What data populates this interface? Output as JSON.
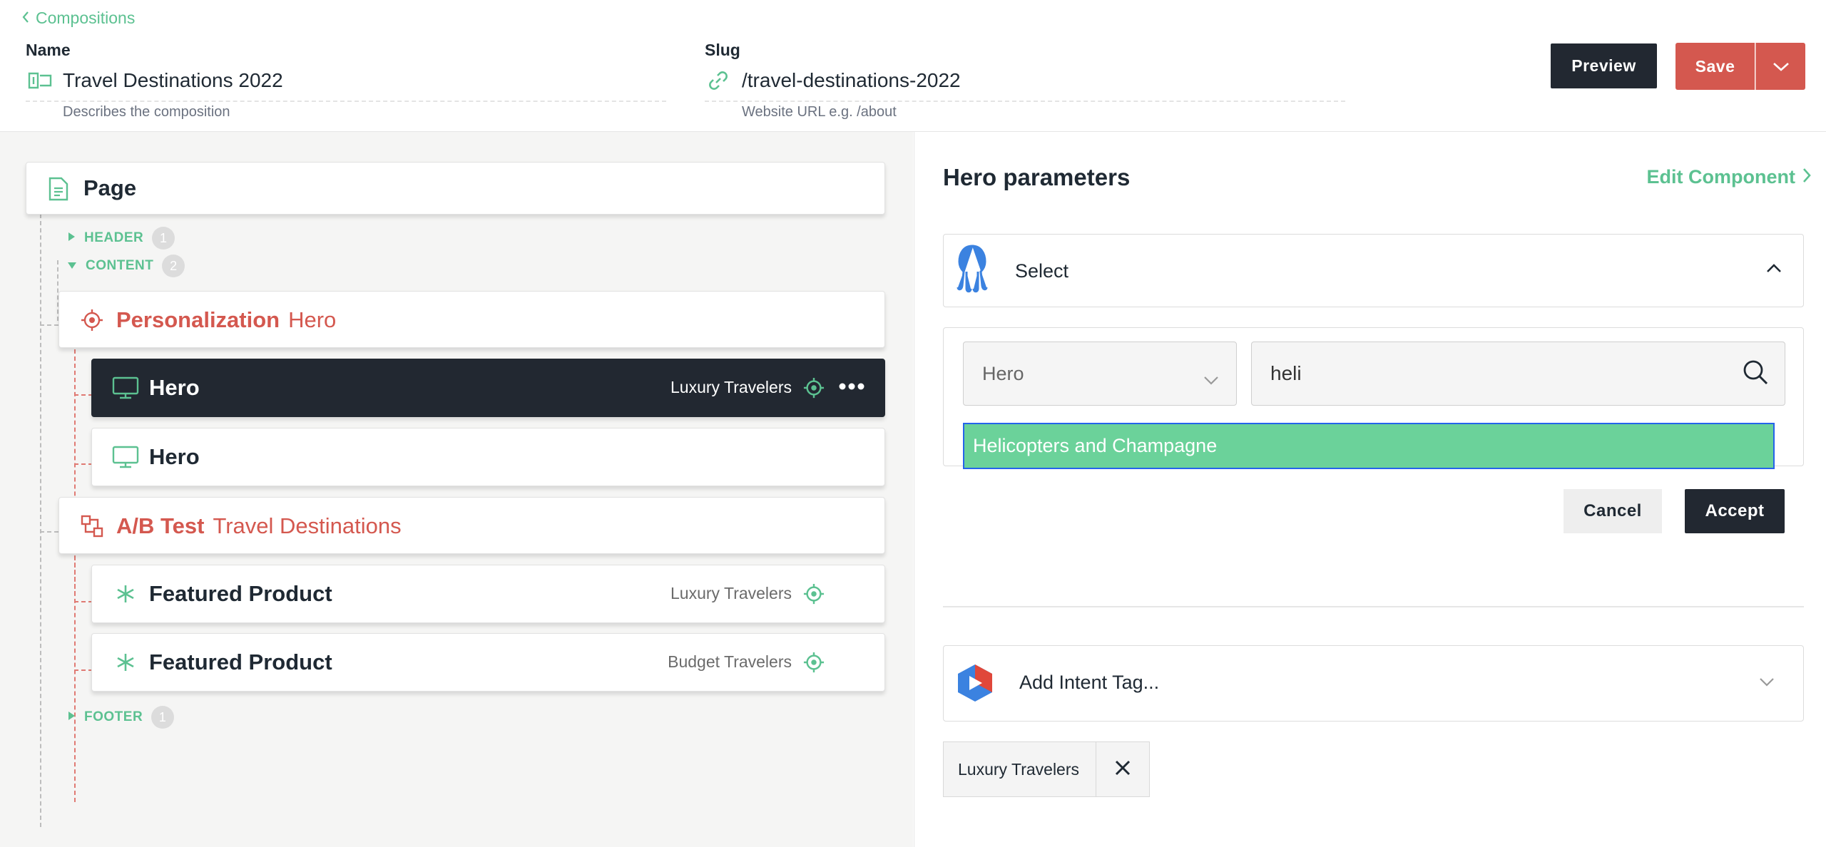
{
  "header": {
    "back_label": "Compositions",
    "name_label": "Name",
    "name_value": "Travel Destinations 2022",
    "name_help": "Describes the composition",
    "slug_label": "Slug",
    "slug_value": "/travel-destinations-2022",
    "slug_help": "Website URL e.g. /about",
    "preview_label": "Preview",
    "save_label": "Save"
  },
  "tree": {
    "root_label": "Page",
    "sections": {
      "header": {
        "label": "HEADER",
        "count": "1"
      },
      "content": {
        "label": "CONTENT",
        "count": "2"
      },
      "footer": {
        "label": "FOOTER",
        "count": "1"
      }
    },
    "personalization": {
      "type": "Personalization",
      "name": "Hero"
    },
    "hero_selected": {
      "label": "Hero",
      "variant": "Luxury Travelers"
    },
    "hero_default": {
      "label": "Hero"
    },
    "ab_test": {
      "type": "A/B Test",
      "name": "Travel Destinations"
    },
    "featured_1": {
      "label": "Featured Product",
      "variant": "Luxury Travelers"
    },
    "featured_2": {
      "label": "Featured Product",
      "variant": "Budget Travelers"
    }
  },
  "panel": {
    "title": "Hero parameters",
    "edit_label": "Edit Component",
    "select_label": "Select",
    "type_dropdown_value": "Hero",
    "search_value": "heli",
    "result_item": "Helicopters and Champagne",
    "cancel_label": "Cancel",
    "accept_label": "Accept",
    "intent_label": "Add Intent Tag...",
    "tag_label": "Luxury Travelers"
  },
  "colors": {
    "accent_green": "#5cc191",
    "accent_red": "#d4584f",
    "dark": "#222831",
    "result_bg": "#6bd29a"
  }
}
